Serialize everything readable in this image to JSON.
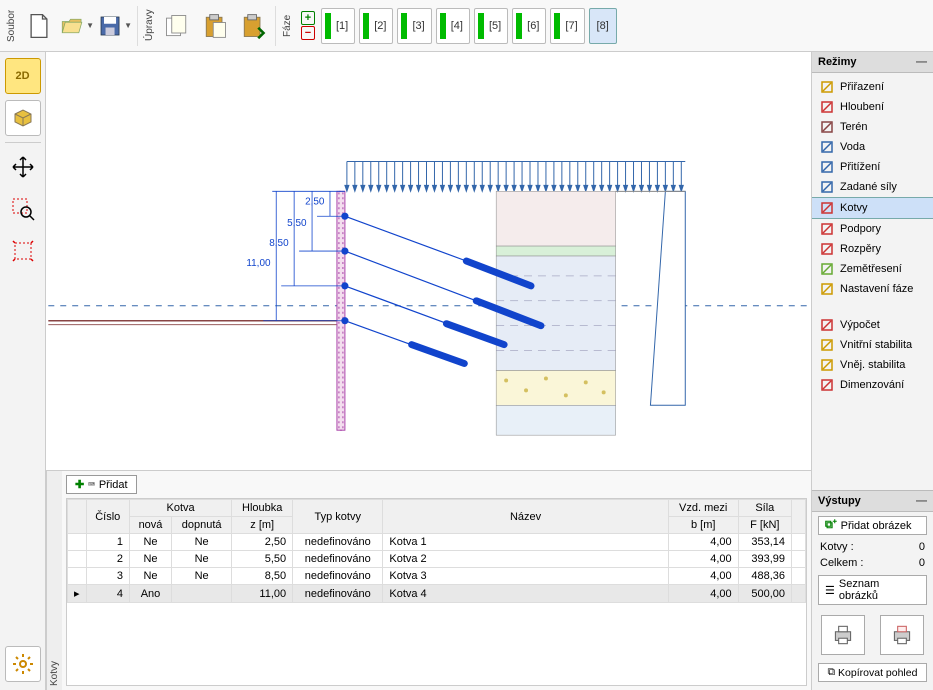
{
  "toolbar": {
    "file_label": "Soubor",
    "edit_label": "Úpravy",
    "phase_label": "Fáze"
  },
  "phases": [
    {
      "label": "[1]",
      "green": true
    },
    {
      "label": "[2]",
      "green": true
    },
    {
      "label": "[3]",
      "green": true
    },
    {
      "label": "[4]",
      "green": true
    },
    {
      "label": "[5]",
      "green": true
    },
    {
      "label": "[6]",
      "green": true
    },
    {
      "label": "[7]",
      "green": true
    },
    {
      "label": "[8]",
      "green": false,
      "active": true
    }
  ],
  "left_tools": {
    "btn2d": "2D",
    "btn3d": "3D"
  },
  "modes": {
    "header": "Režimy",
    "items": [
      {
        "label": "Přiřazení",
        "icon": "assign"
      },
      {
        "label": "Hloubení",
        "icon": "dig"
      },
      {
        "label": "Terén",
        "icon": "terrain"
      },
      {
        "label": "Voda",
        "icon": "water"
      },
      {
        "label": "Přitížení",
        "icon": "surcharge"
      },
      {
        "label": "Zadané síly",
        "icon": "forces"
      },
      {
        "label": "Kotvy",
        "icon": "anchors",
        "active": true
      },
      {
        "label": "Podpory",
        "icon": "supports"
      },
      {
        "label": "Rozpěry",
        "icon": "struts"
      },
      {
        "label": "Zemětřesení",
        "icon": "quake"
      },
      {
        "label": "Nastavení fáze",
        "icon": "phasecfg"
      }
    ],
    "calc_items": [
      {
        "label": "Výpočet",
        "icon": "calc"
      },
      {
        "label": "Vnitřní stabilita",
        "icon": "instab"
      },
      {
        "label": "Vněj. stabilita",
        "icon": "exstab"
      },
      {
        "label": "Dimenzování",
        "icon": "dim"
      }
    ]
  },
  "outputs": {
    "header": "Výstupy",
    "add_image": "Přidat obrázek",
    "row1_label": "Kotvy :",
    "row1_val": "0",
    "row2_label": "Celkem :",
    "row2_val": "0",
    "list_images": "Seznam obrázků",
    "copy_view": "Kopírovat pohled"
  },
  "bottom": {
    "vlabel": "Kotvy",
    "add": "Přidat",
    "headers": {
      "cislo": "Číslo",
      "kotva": "Kotva",
      "nova": "nová",
      "dopnuta": "dopnutá",
      "hloubka": "Hloubka",
      "z": "z [m]",
      "typ": "Typ kotvy",
      "nazev": "Název",
      "vzd": "Vzd. mezi",
      "b": "b [m]",
      "sila": "Síla",
      "f": "F [kN]"
    },
    "rows": [
      {
        "n": "1",
        "nova": "Ne",
        "dop": "Ne",
        "z": "2,50",
        "typ": "nedefinováno",
        "nazev": "Kotva 1",
        "b": "4,00",
        "f": "353,14"
      },
      {
        "n": "2",
        "nova": "Ne",
        "dop": "Ne",
        "z": "5,50",
        "typ": "nedefinováno",
        "nazev": "Kotva 2",
        "b": "4,00",
        "f": "393,99"
      },
      {
        "n": "3",
        "nova": "Ne",
        "dop": "Ne",
        "z": "8,50",
        "typ": "nedefinováno",
        "nazev": "Kotva 3",
        "b": "4,00",
        "f": "488,36"
      },
      {
        "n": "4",
        "nova": "Ano",
        "dop": "",
        "z": "11,00",
        "typ": "nedefinováno",
        "nazev": "Kotva 4",
        "b": "4,00",
        "f": "500,00",
        "selected": true
      }
    ]
  },
  "drawing": {
    "dims": [
      "2,50",
      "5,50",
      "8,50",
      "11,00"
    ]
  }
}
